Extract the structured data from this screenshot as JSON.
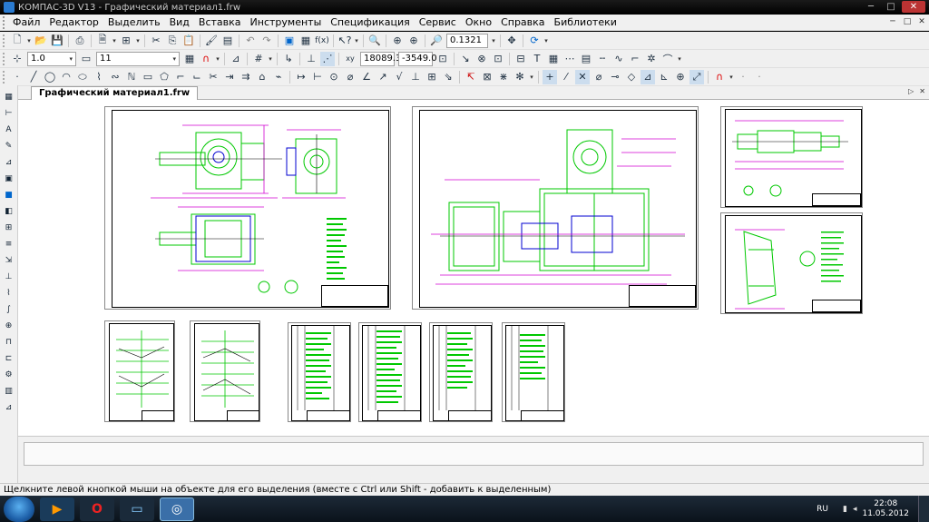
{
  "window": {
    "title": "КОМПАС-3D V13 - Графический материал1.frw",
    "buttons": [
      "─",
      "□",
      "✕"
    ]
  },
  "menu": {
    "items": [
      "Файл",
      "Редактор",
      "Выделить",
      "Вид",
      "Вставка",
      "Инструменты",
      "Спецификация",
      "Сервис",
      "Окно",
      "Справка",
      "Библиотеки"
    ],
    "mdi_buttons": [
      "─",
      "□",
      "✕"
    ]
  },
  "toolbar_standard": {
    "zoom_value": "0.1321"
  },
  "toolbar_current_state": {
    "step_value": "1.0",
    "layer_value": "11",
    "cursor_x": "18089.3",
    "cursor_y": "-3549.0"
  },
  "document": {
    "tab_label": "Графический материал1.frw"
  },
  "status": {
    "hint": "Щелкните левой кнопкой мыши на объекте для его выделения (вместе с Ctrl или Shift - добавить к выделенным)"
  },
  "taskbar": {
    "lang": "RU",
    "time": "22:08",
    "date": "11.05.2012"
  },
  "colors": {
    "drawing_green": "#00c800",
    "drawing_magenta": "#d000d0",
    "drawing_blue": "#0000d0",
    "drawing_black": "#000000"
  }
}
